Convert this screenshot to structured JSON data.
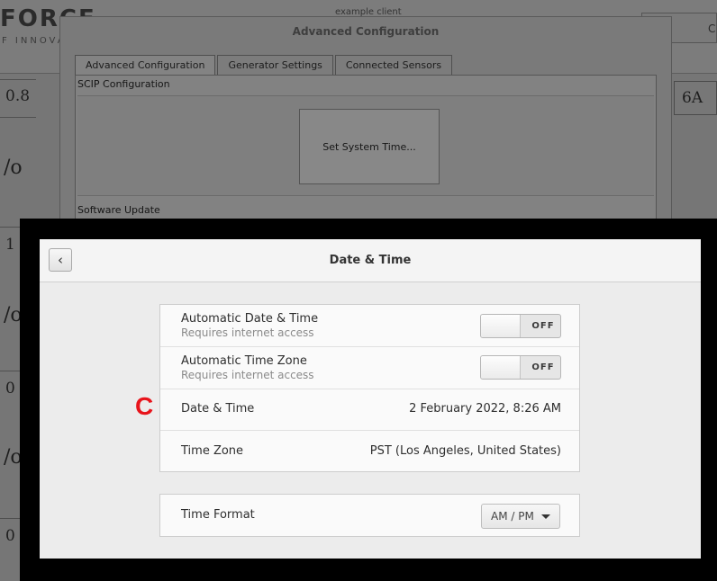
{
  "background_app": {
    "logo": "FORCE",
    "logo_sub": "F INNOVA",
    "hint": "example client",
    "right_label": "C",
    "left_values": [
      "0.8",
      "/o",
      "1",
      "/o",
      "0",
      "/o",
      "0"
    ],
    "right_value": "6A"
  },
  "advanced_config": {
    "title": "Advanced Configuration",
    "tabs": [
      "Advanced Configuration",
      "Generator Settings",
      "Connected Sensors"
    ],
    "active_tab": 0,
    "section_scip": "SCIP Configuration",
    "set_time_button": "Set System Time...",
    "section_update": "Software Update"
  },
  "date_time": {
    "title": "Date & Time",
    "back_icon": "chevron-left-icon",
    "auto_date_time": {
      "label": "Automatic Date & Time",
      "sublabel": "Requires internet access",
      "state": "OFF"
    },
    "auto_time_zone": {
      "label": "Automatic Time Zone",
      "sublabel": "Requires internet access",
      "state": "OFF"
    },
    "date_time_row": {
      "label": "Date & Time",
      "value": "2 February 2022,  8:26 AM"
    },
    "time_zone_row": {
      "label": "Time Zone",
      "value": "PST (Los Angeles, United States)"
    },
    "time_format_row": {
      "label": "Time Format",
      "selected": "AM / PM"
    }
  },
  "annotation": {
    "marker": "C",
    "color": "#e8141b"
  }
}
